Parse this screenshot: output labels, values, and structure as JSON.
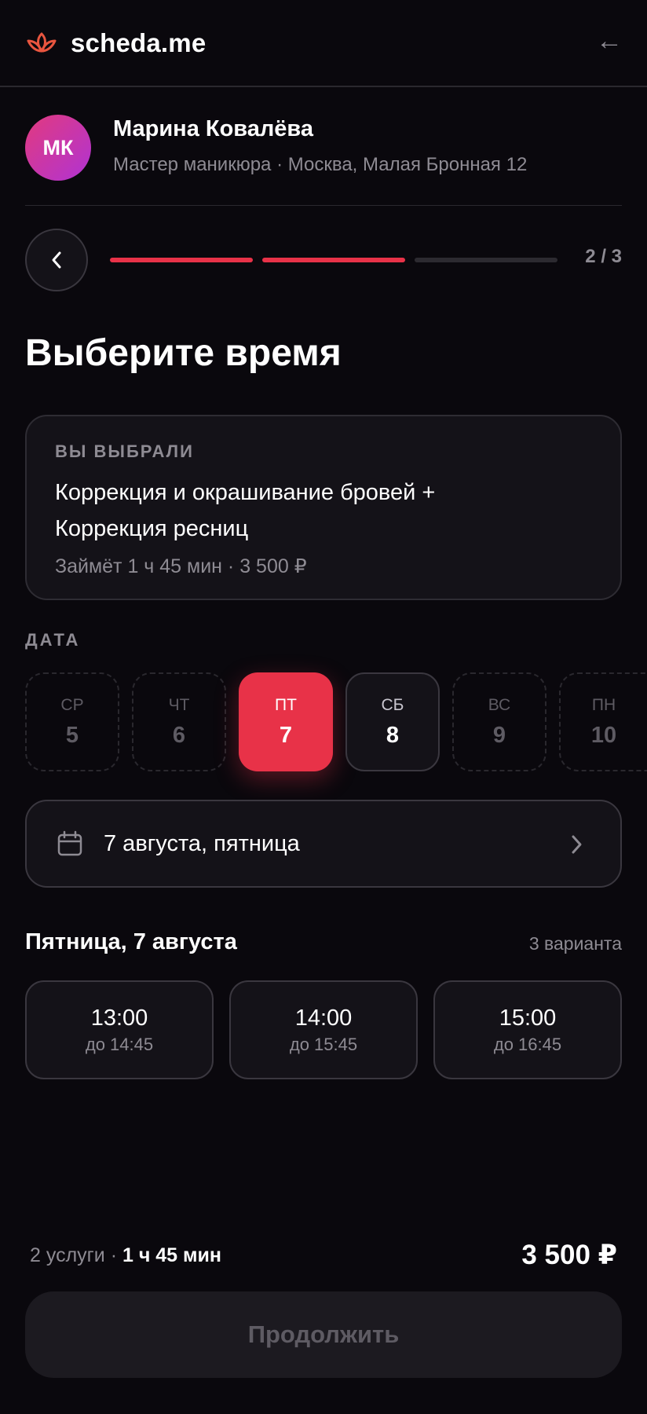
{
  "header": {
    "brand": "scheda.me",
    "back_glyph": "←"
  },
  "master": {
    "initials": "МК",
    "name": "Марина Ковалёва",
    "subtitle": "Мастер маникюра · Москва, Малая Бронная 12"
  },
  "progress": {
    "step_label": "2 / 3",
    "current": 2,
    "total": 3
  },
  "page_title": "Выберите время",
  "selection": {
    "caption": "ВЫ ВЫБРАЛИ",
    "services": "Коррекция и окрашивание бровей + Коррекция ресниц",
    "meta": "Займёт 1 ч 45 мин · 3 500 ₽"
  },
  "date_caption": "ДАТА",
  "dates": [
    {
      "dow": "СР",
      "day": "5",
      "state": "disabled"
    },
    {
      "dow": "ЧТ",
      "day": "6",
      "state": "disabled"
    },
    {
      "dow": "ПТ",
      "day": "7",
      "state": "selected"
    },
    {
      "dow": "СБ",
      "day": "8",
      "state": "available"
    },
    {
      "dow": "ВС",
      "day": "9",
      "state": "disabled"
    },
    {
      "dow": "ПН",
      "day": "10",
      "state": "disabled"
    }
  ],
  "date_picker_label": "7 августа, пятница",
  "day_title": "Пятница, 7 августа",
  "variants_count": "3 варианта",
  "slots": [
    {
      "time": "13:00",
      "until": "до 14:45"
    },
    {
      "time": "14:00",
      "until": "до 15:45"
    },
    {
      "time": "15:00",
      "until": "до 16:45"
    }
  ],
  "footer": {
    "services_count": "2 услуги",
    "separator": " · ",
    "duration": "1 ч 45 мин",
    "total": "3 500 ₽",
    "continue_label": "Продолжить"
  },
  "colors": {
    "accent": "#e83248",
    "background": "#0a080d",
    "card": "#141218",
    "muted_text": "#8e8b93"
  },
  "icons": [
    "lotus-logo-icon",
    "arrow-left-icon",
    "chevron-left-icon",
    "calendar-icon",
    "chevron-right-icon"
  ]
}
